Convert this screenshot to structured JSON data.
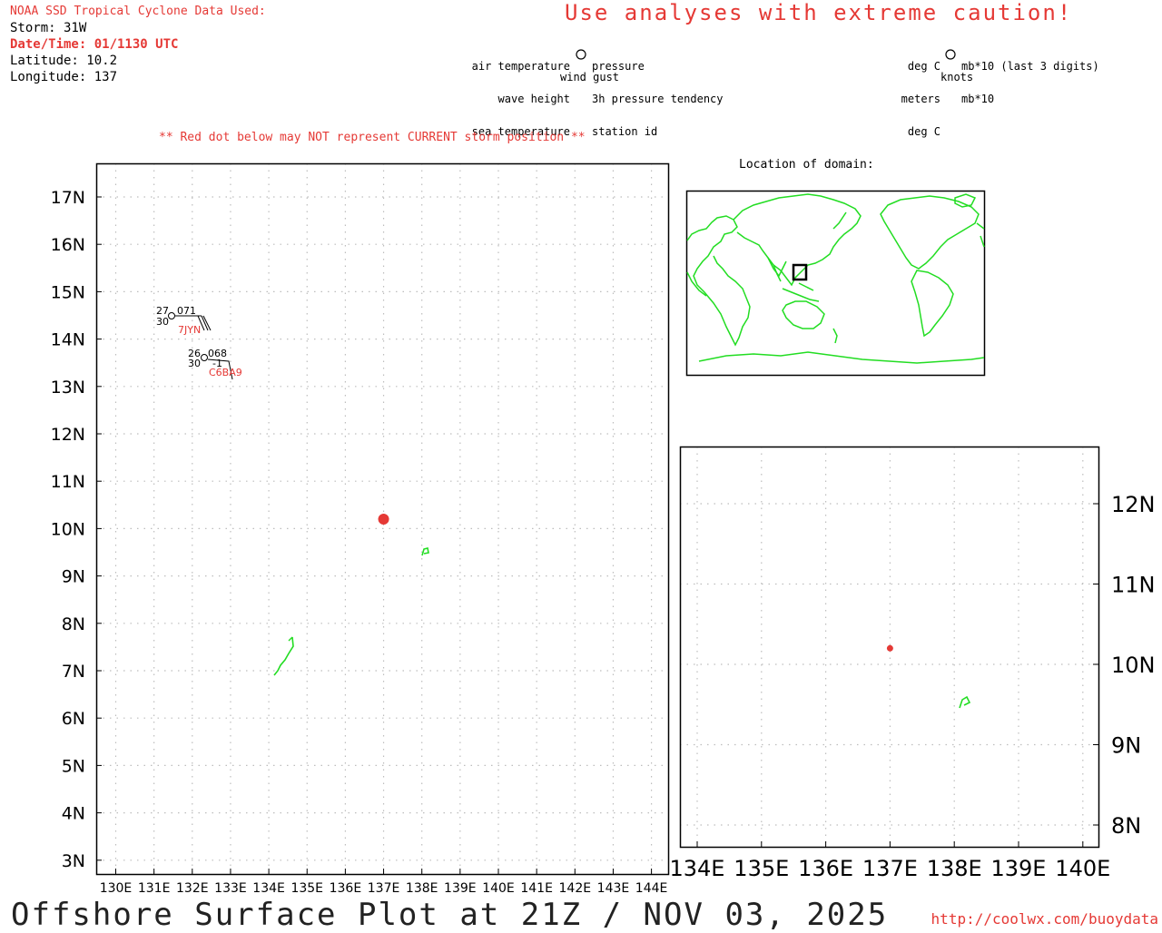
{
  "header": {
    "source": "NOAA SSD Tropical Cyclone Data Used:",
    "storm": "Storm: 31W",
    "datetime": "Date/Time: 01/1130 UTC",
    "latitude": "Latitude: 10.2",
    "longitude": "Longitude: 137"
  },
  "caution": "Use analyses with extreme caution!",
  "legend": {
    "left": [
      "air temperature",
      "wave height",
      "sea temperature"
    ],
    "right": [
      "pressure",
      "3h pressure tendency",
      "station id"
    ],
    "bottom": "wind gust",
    "units_left": [
      "deg C",
      "meters",
      "deg C"
    ],
    "units_right": [
      "mb*10 (last 3 digits)",
      "mb*10"
    ],
    "units_bottom": "knots"
  },
  "warning": "** Red dot below may NOT represent CURRENT storm position **",
  "location_title": "Location of domain:",
  "main_map": {
    "lat_labels": [
      "17N",
      "16N",
      "15N",
      "14N",
      "13N",
      "12N",
      "11N",
      "10N",
      "9N",
      "8N",
      "7N",
      "6N",
      "5N",
      "4N",
      "3N"
    ],
    "lon_labels": [
      "130E",
      "131E",
      "132E",
      "133E",
      "134E",
      "135E",
      "136E",
      "137E",
      "138E",
      "139E",
      "140E",
      "141E",
      "142E",
      "143E",
      "144E"
    ],
    "storm_position": {
      "lat": 10.2,
      "lon": 137
    },
    "stations": [
      {
        "id": "7JYN",
        "air_temp": "27",
        "sea_temp": "30",
        "pressure": "071",
        "lat": 14.5,
        "lon": 131.5
      },
      {
        "id": "C6BA9",
        "air_temp": "26",
        "sea_temp": "30",
        "pressure": "068",
        "tendency": "-1",
        "lat": 13.6,
        "lon": 132.3
      }
    ]
  },
  "zoom_map": {
    "lat_labels": [
      "12N",
      "11N",
      "10N",
      "9N",
      "8N"
    ],
    "lon_labels": [
      "134E",
      "135E",
      "136E",
      "137E",
      "138E",
      "139E",
      "140E"
    ]
  },
  "footer": {
    "title": "Offshore Surface Plot at 21Z / NOV 03, 2025",
    "url": "http://coolwx.com/buoydata"
  },
  "colors": {
    "storm": "#e53935",
    "land": "#22dd22",
    "grid": "#bdbdbd",
    "station_id": "#e53935"
  }
}
